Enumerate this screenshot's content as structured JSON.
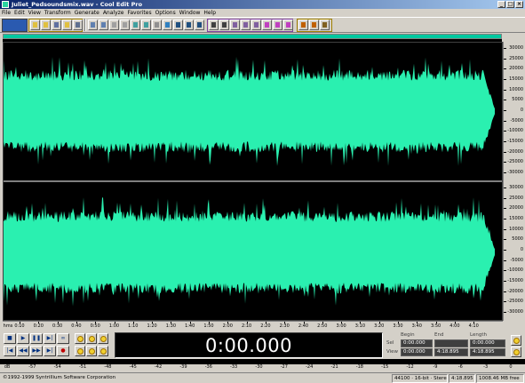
{
  "window": {
    "title": "Juliet_Pedsoundsmix.wav - Cool Edit Pro"
  },
  "menu": [
    "File",
    "Edit",
    "View",
    "Transform",
    "Generate",
    "Analyze",
    "Favorites",
    "Options",
    "Window",
    "Help"
  ],
  "colors": {
    "waveform": "#2af0b0",
    "waveform_bg": "#000000",
    "overview": "#00c8a0",
    "time_display_text": "#ffffff"
  },
  "amplitude_labels_top": [
    "30000",
    "25000",
    "20000",
    "15000",
    "10000",
    "5000",
    "0",
    "-5000",
    "-10000",
    "-15000",
    "-20000",
    "-25000",
    "-30000"
  ],
  "amplitude_labels_bottom": [
    "30000",
    "25000",
    "20000",
    "15000",
    "10000",
    "5000",
    "0",
    "-5000",
    "-10000",
    "-15000",
    "-20000",
    "-25000",
    "-30000"
  ],
  "time_ruler": {
    "units": "hms",
    "labels": [
      "0:10",
      "0:20",
      "0:30",
      "0:40",
      "0:50",
      "1:00",
      "1:10",
      "1:20",
      "1:30",
      "1:40",
      "1:50",
      "2:00",
      "2:10",
      "2:20",
      "2:30",
      "2:40",
      "2:50",
      "3:00",
      "3:10",
      "3:20",
      "3:30",
      "3:40",
      "3:50",
      "4:00",
      "4:10"
    ]
  },
  "transport": {
    "time_display": "0:00.000",
    "buttons": [
      "stop-icon",
      "play-icon",
      "pause-icon",
      "play-to-end-icon",
      "loop-icon",
      "go-to-start-icon",
      "rewind-icon",
      "fast-forward-icon",
      "go-to-end-icon",
      "record-icon"
    ]
  },
  "selection_view": {
    "headers": {
      "begin": "Begin",
      "end": "End",
      "length": "Length"
    },
    "rows": [
      {
        "label": "Sel",
        "begin": "0:00.000",
        "end": "",
        "length": "0:00.000"
      },
      {
        "label": "View",
        "begin": "0:00.000",
        "end": "4:18.895",
        "length": "4:18.895"
      }
    ]
  },
  "level_meter": {
    "labels": [
      "dB",
      "-57",
      "-54",
      "-51",
      "-48",
      "-45",
      "-42",
      "-39",
      "-36",
      "-33",
      "-30",
      "-27",
      "-24",
      "-21",
      "-18",
      "-15",
      "-12",
      "-9",
      "-6",
      "-3",
      "0"
    ]
  },
  "status": {
    "copyright": "©1992-1999 Syntrillium Software Corporation",
    "format": "44100 · 16-bit · Stereo",
    "file_size": "45.60 MB",
    "duration": "4:18.895",
    "free_space": "1008.46 MB free"
  }
}
